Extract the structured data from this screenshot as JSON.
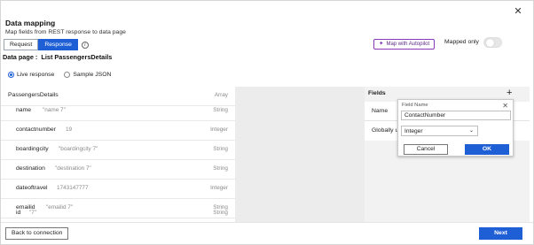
{
  "dialog": {
    "title": "Data mapping",
    "subtitle": "Map fields from REST response to data page",
    "close_glyph": "✕"
  },
  "tabs": [
    {
      "label": "Request",
      "active": false
    },
    {
      "label": "Response",
      "active": true
    }
  ],
  "info_glyph": "i",
  "autopilot": {
    "icon": "sparkle-icon",
    "glyph": "✦",
    "label": "Map with Autopilot"
  },
  "mapped_only": {
    "label": "Mapped only",
    "on": false
  },
  "data_page": {
    "label": "Data page :",
    "name": "List PassengersDetails"
  },
  "source": {
    "options": [
      "Live response",
      "Sample JSON"
    ],
    "selected": "Live response"
  },
  "response_tree": {
    "root": {
      "name": "PassengersDetails",
      "type": "Array"
    },
    "fields": [
      {
        "name": "name",
        "value": "\"name 7\"",
        "type": "String"
      },
      {
        "name": "contactnumber",
        "value": "19",
        "type": "Integer"
      },
      {
        "name": "boardingcity",
        "value": "\"boardingcity 7\"",
        "type": "String"
      },
      {
        "name": "destination",
        "value": "\"destination 7\"",
        "type": "String"
      },
      {
        "name": "dateoftravel",
        "value": "1743147777",
        "type": "Integer"
      },
      {
        "name": "emailid",
        "value": "\"emailid 7\"",
        "type": "String"
      },
      {
        "name": "id",
        "value": "\"7\"",
        "type": "String"
      }
    ]
  },
  "fields_panel": {
    "title": "Fields",
    "add_glyph": "+",
    "rows": [
      "Name",
      "Globally u"
    ]
  },
  "add_field_popover": {
    "label": "Field Name",
    "close_glyph": "✕",
    "field_value": "ContactNumber",
    "type_selected": "Integer",
    "chevron_glyph": "⌄",
    "cancel_label": "Cancel",
    "ok_label": "OK"
  },
  "footer": {
    "back_label": "Back to connection",
    "next_label": "Next"
  },
  "colors": {
    "primary": "#1f5fd6",
    "autopilot": "#8a3ab9"
  }
}
